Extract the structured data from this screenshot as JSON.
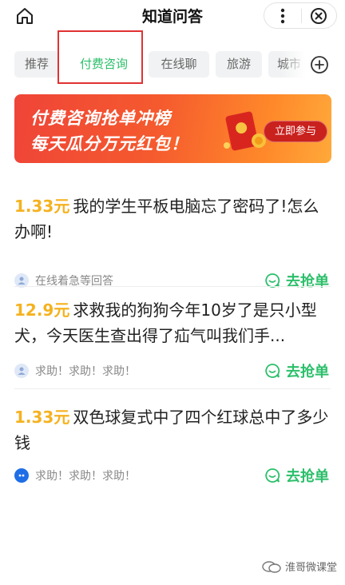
{
  "header": {
    "title": "知道问答"
  },
  "tabs": [
    {
      "label": "推荐"
    },
    {
      "label": "付费咨询"
    },
    {
      "label": "在线聊"
    },
    {
      "label": "旅游"
    },
    {
      "label": "城市"
    }
  ],
  "banner": {
    "line1": "付费咨询抢单冲榜",
    "line2": "每天瓜分万元红包！",
    "button": "立即参与"
  },
  "questions": [
    {
      "price": "1.33元",
      "text": "我的学生平板电脑忘了密码了!怎么办啊!",
      "status": "在线着急等回答",
      "action": "去抢单"
    },
    {
      "price": "12.9元",
      "text": "求救我的狗狗今年10岁了是只小型犬，今天医生查出得了疝气叫我们手...",
      "status": "求助！求助！求助！",
      "action": "去抢单"
    },
    {
      "price": "1.33元",
      "text": "双色球复式中了四个红球总中了多少钱",
      "status": "求助！求助！求助！",
      "action": "去抢单"
    }
  ],
  "watermark": {
    "text": "淮哥微课堂"
  },
  "colors": {
    "accent_green": "#2bbf6a",
    "price_orange": "#f5b21f",
    "highlight_red": "#e03232"
  }
}
